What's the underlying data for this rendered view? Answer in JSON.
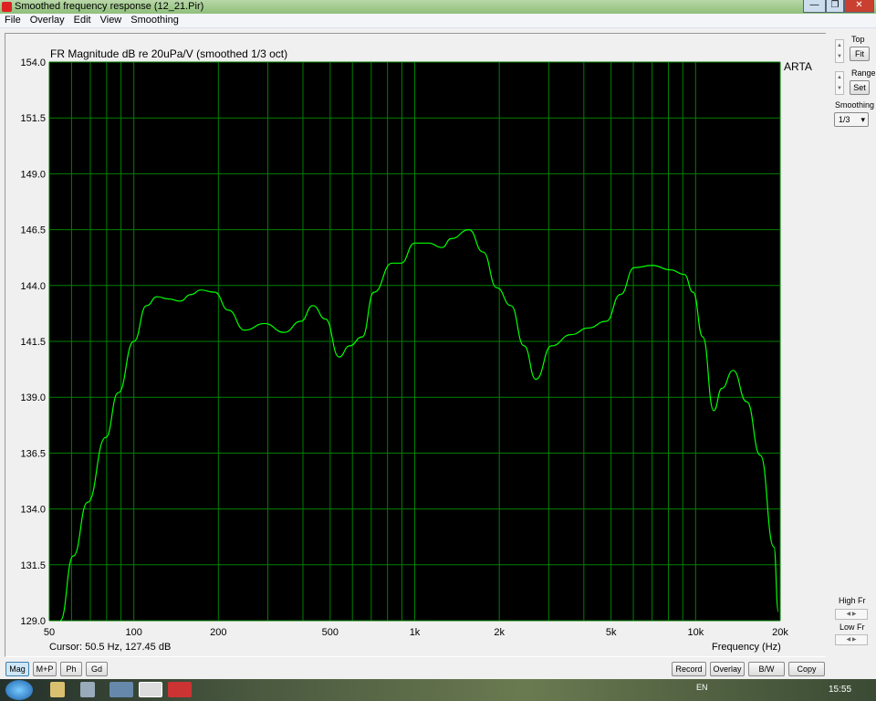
{
  "window": {
    "title": "Smoothed frequency response (12_21.Pir)",
    "min": "—",
    "max": "❐",
    "close": "✕"
  },
  "menu": [
    "File",
    "Overlay",
    "Edit",
    "View",
    "Smoothing"
  ],
  "side": {
    "top_label": "Top",
    "fit": "Fit",
    "range_label": "Range",
    "set": "Set",
    "smoothing_label": "Smoothing",
    "smoothing_value": "1/3",
    "high_fr": "High Fr",
    "low_fr": "Low Fr"
  },
  "arta": "ARTA",
  "cursor": "Cursor: 50.5 Hz, 127.45 dB",
  "bottom_left": [
    "Mag",
    "M+P",
    "Ph",
    "Gd"
  ],
  "bottom_right": [
    "Record",
    "Overlay",
    "B/W",
    "Copy"
  ],
  "taskbar": {
    "lang": "EN",
    "time": "15:55"
  },
  "colors": {
    "curve": "#00ff00",
    "grid": "#008000",
    "bg": "#000000"
  },
  "chart_data": {
    "type": "line",
    "title": "FR Magnitude dB re 20uPa/V (smoothed 1/3 oct)",
    "xlabel": "Frequency (Hz)",
    "ylabel": "dB",
    "xscale": "log",
    "xlim": [
      50,
      20000
    ],
    "ylim": [
      129,
      154
    ],
    "xticks": [
      {
        "v": 50,
        "l": "50"
      },
      {
        "v": 100,
        "l": "100"
      },
      {
        "v": 200,
        "l": "200"
      },
      {
        "v": 500,
        "l": "500"
      },
      {
        "v": 1000,
        "l": "1k"
      },
      {
        "v": 2000,
        "l": "2k"
      },
      {
        "v": 5000,
        "l": "5k"
      },
      {
        "v": 10000,
        "l": "10k"
      },
      {
        "v": 20000,
        "l": "20k"
      }
    ],
    "yticks": [
      "154.0",
      "151.5",
      "149.0",
      "146.5",
      "144.0",
      "141.5",
      "139.0",
      "136.5",
      "134.0",
      "131.5",
      "129.0"
    ],
    "grid": true,
    "series": [
      {
        "name": "FR magnitude",
        "x": [
          54.7,
          60.9,
          68.5,
          79.4,
          88,
          100,
          111,
          121,
          133,
          146,
          160,
          173,
          194,
          217,
          248,
          292,
          343,
          393,
          434,
          481,
          538,
          586,
          650,
          716,
          830,
          893,
          1000,
          1120,
          1250,
          1350,
          1560,
          1750,
          1960,
          2200,
          2450,
          2700,
          3070,
          3600,
          4150,
          4800,
          5400,
          6050,
          7000,
          8140,
          9100,
          9800,
          10600,
          11600,
          12400,
          13600,
          15200,
          17000,
          19000,
          19700
        ],
        "y": [
          129.0,
          131.9,
          134.3,
          137.2,
          139.2,
          141.5,
          143.1,
          143.5,
          143.4,
          143.3,
          143.6,
          143.8,
          143.7,
          142.9,
          142.0,
          142.3,
          141.9,
          142.4,
          143.1,
          142.5,
          140.8,
          141.3,
          141.7,
          143.7,
          145.0,
          145.0,
          145.9,
          145.9,
          145.7,
          146.1,
          146.5,
          145.5,
          143.9,
          143.1,
          141.3,
          139.8,
          141.3,
          141.8,
          142.1,
          142.4,
          143.6,
          144.8,
          144.9,
          144.7,
          144.5,
          143.7,
          141.7,
          138.4,
          139.4,
          140.2,
          138.8,
          136.4,
          132.3,
          129.4
        ]
      }
    ]
  }
}
